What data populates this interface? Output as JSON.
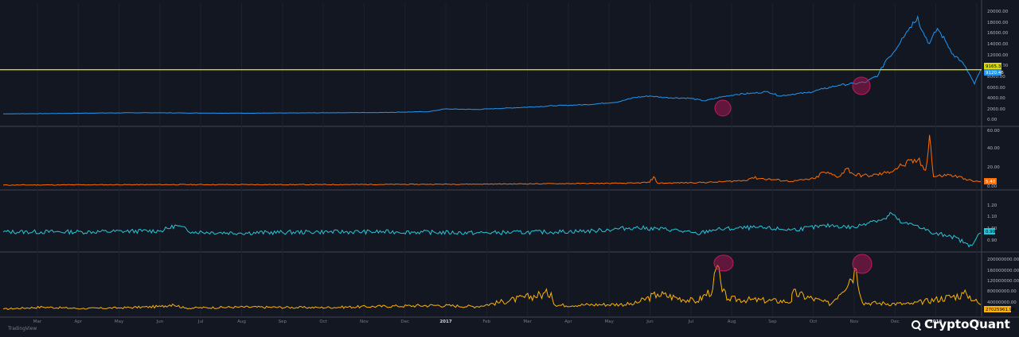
{
  "brand": {
    "tradingview": "TradingView",
    "cryptoquant": "CryptoQuant"
  },
  "colors": {
    "background": "#131722",
    "pane_border": "#434651",
    "price": "#2196f3",
    "level": "#d9d90c",
    "pane2": "#ff6d00",
    "pane3": "#26c6da",
    "pane4": "#ffb300",
    "highlight": "#c2185b"
  },
  "chart_data": [
    {
      "type": "line",
      "pane": "price",
      "yticks": [
        "20000.00",
        "18000.00",
        "16000.00",
        "14000.00",
        "12000.00",
        "10000.00",
        "8000.00",
        "6000.00",
        "4000.00",
        "2000.00",
        "0.00"
      ],
      "ylim": [
        0,
        20000
      ],
      "series": [
        {
          "x": [
            0,
            60,
            120,
            180,
            240,
            300,
            360,
            420,
            480,
            540,
            560,
            600,
            660,
            700,
            740,
            780,
            800,
            820,
            840,
            870,
            890,
            910,
            930,
            950,
            970,
            985,
            1000,
            1020,
            1040,
            1060,
            1080,
            1095,
            1110,
            1120,
            1130,
            1140,
            1150,
            1160,
            1165,
            1175,
            1185,
            1195,
            1205,
            1215,
            1225,
            1232,
            1240
          ],
          "values": [
            1000,
            1050,
            1150,
            1200,
            1150,
            1120,
            1150,
            1200,
            1250,
            1400,
            1900,
            1800,
            2200,
            2500,
            2700,
            3200,
            4000,
            4300,
            4000,
            3900,
            3400,
            4100,
            4600,
            4800,
            5100,
            4300,
            4600,
            4900,
            5600,
            6300,
            6600,
            6900,
            8200,
            11000,
            12500,
            15000,
            17000,
            19000,
            16500,
            14000,
            16800,
            14500,
            12000,
            10800,
            8500,
            6500,
            9200
          ]
        }
      ],
      "level_line": 9165.38,
      "badges": [
        "9165.38",
        "9120.46"
      ]
    },
    {
      "type": "line",
      "pane": "pane2",
      "yticks": [
        "60.00",
        "40.00",
        "20.00",
        "0.00"
      ],
      "ylim": [
        0,
        60
      ],
      "series": [
        {
          "x": [
            0,
            200,
            400,
            600,
            700,
            800,
            820,
            825,
            830,
            900,
            940,
            950,
            1000,
            1030,
            1040,
            1060,
            1070,
            1080,
            1100,
            1120,
            1140,
            1160,
            1170,
            1175,
            1180,
            1200,
            1220,
            1230,
            1240
          ],
          "values": [
            1,
            1.5,
            1.5,
            2,
            2.5,
            3,
            4,
            10,
            3,
            4,
            6,
            9,
            5,
            8,
            15,
            10,
            19,
            12,
            11,
            14,
            22,
            28,
            17,
            55,
            10,
            12,
            8,
            5,
            5
          ]
        }
      ],
      "badges": [
        "5.40"
      ]
    },
    {
      "type": "line",
      "pane": "pane3",
      "yticks": [
        "1.20",
        "1.10",
        "1.00",
        "0.90"
      ],
      "ylim": [
        0.85,
        1.25
      ],
      "series": [
        {
          "x": [
            0,
            100,
            200,
            220,
            240,
            300,
            400,
            500,
            600,
            700,
            750,
            800,
            850,
            880,
            900,
            950,
            1000,
            1050,
            1080,
            1100,
            1120,
            1125,
            1140,
            1160,
            1180,
            1200,
            1220,
            1225,
            1240
          ],
          "values": [
            1.0,
            1.0,
            1.01,
            1.06,
            1.0,
            0.99,
            1.0,
            1.0,
            0.99,
            1.0,
            1.01,
            1.04,
            1.02,
            0.98,
            1.02,
            1.04,
            1.02,
            1.06,
            1.04,
            1.1,
            1.12,
            1.18,
            1.08,
            1.06,
            0.98,
            0.97,
            0.9,
            0.86,
            0.99
          ]
        }
      ],
      "badges": [
        "0.99"
      ]
    },
    {
      "type": "line",
      "pane": "pane4",
      "yticks": [
        "200000000.00",
        "160000000.00",
        "120000000.00",
        "80000000.00",
        "40000000.00"
      ],
      "ylim": [
        0,
        210000000
      ],
      "series": [
        {
          "x": [
            0,
            50,
            100,
            150,
            200,
            215,
            230,
            300,
            400,
            500,
            550,
            600,
            695,
            700,
            800,
            830,
            880,
            900,
            906,
            912,
            920,
            1000,
            1001,
            1050,
            1082,
            1090,
            1150,
            1222,
            1240
          ],
          "values": [
            10000000,
            18000000,
            12000000,
            15000000,
            20000000,
            30000000,
            14000000,
            18000000,
            16000000,
            22000000,
            25000000,
            20000000,
            75000000,
            25000000,
            30000000,
            70000000,
            40000000,
            90000000,
            185000000,
            80000000,
            50000000,
            40000000,
            75000000,
            30000000,
            170000000,
            35000000,
            30000000,
            70000000,
            27000000
          ]
        }
      ],
      "badges": [
        "27025961.98"
      ]
    }
  ],
  "xaxis": {
    "labels": [
      "Mar",
      "Apr",
      "May",
      "Jun",
      "Jul",
      "Aug",
      "Sep",
      "Oct",
      "Nov",
      "Dec",
      "2017",
      "Feb",
      "Mar",
      "Apr",
      "May",
      "Jun",
      "Jul",
      "Aug",
      "Sep",
      "Oct",
      "Nov",
      "Dec",
      "2018",
      "Feb"
    ],
    "year_labels": [
      "2017",
      "2018"
    ]
  }
}
